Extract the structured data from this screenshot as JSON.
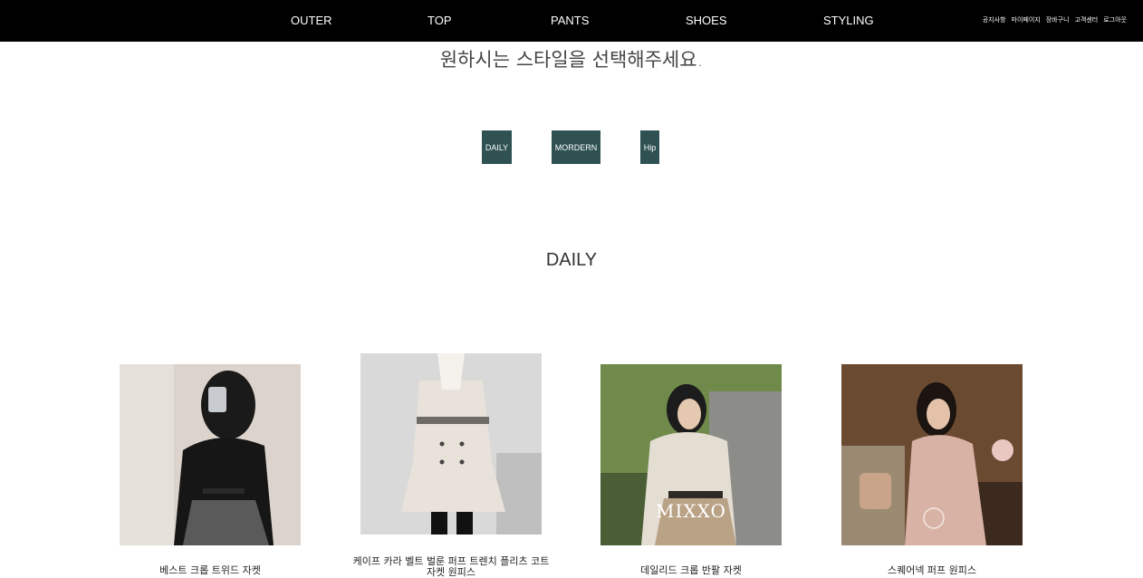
{
  "nav": {
    "items": [
      "OUTER",
      "TOP",
      "PANTS",
      "SHOES",
      "STYLING"
    ],
    "util": [
      "공지사항",
      "마이페이지",
      "장바구니",
      "고객센터",
      "로그아웃"
    ]
  },
  "prompt": "원하시는 스타일을 선택해주세요.",
  "style_buttons": [
    "DAILY",
    "MORDERN",
    "Hip"
  ],
  "section_title": "DAILY",
  "products": [
    {
      "name": "베스트 크롭 트위드 자켓"
    },
    {
      "name": "케이프 카라 벨트 벌룬 퍼프 트렌치 플리츠 코트 자켓 원피스"
    },
    {
      "name": "데일리드 크롭 반팔 자켓",
      "watermark": "MIXXO"
    },
    {
      "name": "스퀘어넥 퍼프 원피스"
    }
  ],
  "colors": {
    "nav_bg": "#000000",
    "button_bg": "#2f5152"
  }
}
